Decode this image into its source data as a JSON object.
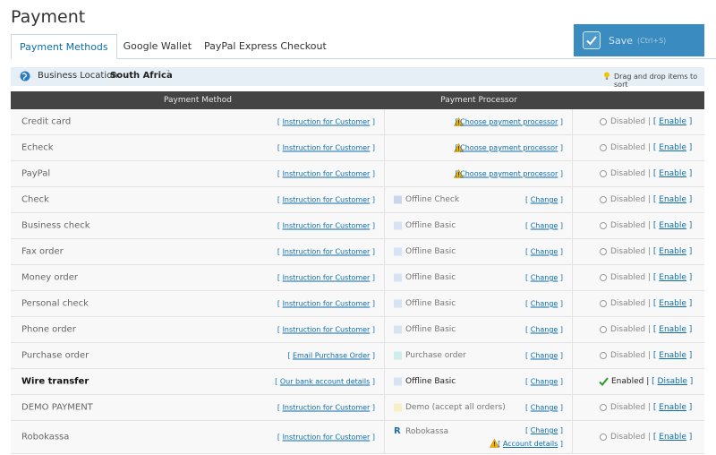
{
  "page": {
    "title": "Payment",
    "tabs": [
      {
        "label": "Payment Methods",
        "active": true
      },
      {
        "label": "Google Wallet",
        "active": false
      },
      {
        "label": "PayPal Express Checkout",
        "active": false
      }
    ]
  },
  "save": {
    "label": "Save",
    "shortcut": "(Ctrl+S)"
  },
  "location": {
    "label": "Business Location:",
    "value": "South Africa",
    "help": "?",
    "drag_hint": "Drag and drop items to sort"
  },
  "table": {
    "headers": {
      "method": "Payment Method",
      "processor": "Payment Processor"
    },
    "rows": [
      {
        "name": "Credit card",
        "bold": false,
        "link_open": "[ ",
        "link": "Instruction for Customer",
        "link_close": " ]",
        "processor": {
          "type": "choose",
          "warn_icon": "warning-icon",
          "link": "Choose payment processor"
        },
        "status": {
          "enabled": false,
          "text": "Disabled",
          "sep": "|",
          "action": "Enable"
        }
      },
      {
        "name": "Echeck",
        "bold": false,
        "link_open": "[ ",
        "link": "Instruction for Customer",
        "link_close": " ]",
        "processor": {
          "type": "choose",
          "warn_icon": "warning-icon",
          "link": "Choose payment processor"
        },
        "status": {
          "enabled": false,
          "text": "Disabled",
          "sep": "|",
          "action": "Enable"
        }
      },
      {
        "name": "PayPal",
        "bold": false,
        "link_open": "[ ",
        "link": "Instruction for Customer",
        "link_close": " ]",
        "processor": {
          "type": "choose",
          "warn_icon": "warning-icon",
          "link": "Choose payment processor"
        },
        "status": {
          "enabled": false,
          "text": "Disabled",
          "sep": "|",
          "action": "Enable"
        }
      },
      {
        "name": "Check",
        "bold": false,
        "link_open": "[ ",
        "link": "Instruction for Customer",
        "link_close": " ]",
        "processor": {
          "type": "named",
          "name": "Offline Check",
          "swatch": "#c9d6ee",
          "link": "Change"
        },
        "status": {
          "enabled": false,
          "text": "Disabled",
          "sep": "|",
          "action": "Enable"
        }
      },
      {
        "name": "Business check",
        "bold": false,
        "link_open": "[ ",
        "link": "Instruction for Customer",
        "link_close": " ]",
        "processor": {
          "type": "named",
          "name": "Offline Basic",
          "swatch": "#d5e3f2",
          "link": "Change"
        },
        "status": {
          "enabled": false,
          "text": "Disabled",
          "sep": "|",
          "action": "Enable"
        }
      },
      {
        "name": "Fax order",
        "bold": false,
        "link_open": "[ ",
        "link": "Instruction for Customer",
        "link_close": " ]",
        "processor": {
          "type": "named",
          "name": "Offline Basic",
          "swatch": "#d5e3f2",
          "link": "Change"
        },
        "status": {
          "enabled": false,
          "text": "Disabled",
          "sep": "|",
          "action": "Enable"
        }
      },
      {
        "name": "Money order",
        "bold": false,
        "link_open": "[ ",
        "link": "Instruction for Customer",
        "link_close": " ]",
        "processor": {
          "type": "named",
          "name": "Offline Basic",
          "swatch": "#d5e3f2",
          "link": "Change"
        },
        "status": {
          "enabled": false,
          "text": "Disabled",
          "sep": "|",
          "action": "Enable"
        }
      },
      {
        "name": "Personal check",
        "bold": false,
        "link_open": "[ ",
        "link": "Instruction for Customer",
        "link_close": " ]",
        "processor": {
          "type": "named",
          "name": "Offline Basic",
          "swatch": "#d5e3f2",
          "link": "Change"
        },
        "status": {
          "enabled": false,
          "text": "Disabled",
          "sep": "|",
          "action": "Enable"
        }
      },
      {
        "name": "Phone order",
        "bold": false,
        "link_open": "[ ",
        "link": "Instruction for Customer",
        "link_close": " ]",
        "processor": {
          "type": "named",
          "name": "Offline Basic",
          "swatch": "#d5e3f2",
          "link": "Change"
        },
        "status": {
          "enabled": false,
          "text": "Disabled",
          "sep": "|",
          "action": "Enable"
        }
      },
      {
        "name": "Purchase order",
        "bold": false,
        "link_open": "[ ",
        "link": "Email Purchase Order",
        "link_close": " ]",
        "processor": {
          "type": "named",
          "name": "Purchase order",
          "swatch": "#cdeeed",
          "link": "Change"
        },
        "status": {
          "enabled": false,
          "text": "Disabled",
          "sep": "|",
          "action": "Enable"
        }
      },
      {
        "name": "Wire transfer",
        "bold": true,
        "link_open": "[ ",
        "link": "Our bank account details",
        "link_close": " ]",
        "processor": {
          "type": "named",
          "name": "Offline Basic",
          "swatch": "#d5e3f2",
          "link": "Change",
          "dark": true
        },
        "status": {
          "enabled": true,
          "text": "Enabled",
          "sep": "|",
          "action": "Disable"
        }
      },
      {
        "name": "DEMO PAYMENT",
        "bold": false,
        "link_open": "[ ",
        "link": "Instruction for Customer",
        "link_close": " ]",
        "processor": {
          "type": "named",
          "name": "Demo (accept all orders)",
          "swatch": "#f7efc7",
          "link": "Change"
        },
        "status": {
          "enabled": false,
          "text": "Disabled",
          "sep": "|",
          "action": "Enable"
        }
      },
      {
        "name": "Robokassa",
        "bold": false,
        "link_open": "[ ",
        "link": "Instruction for Customer",
        "link_close": " ]",
        "processor": {
          "type": "robokassa",
          "logo": "R",
          "name": "Robokassa",
          "link": "Change",
          "details": "Account details"
        },
        "status": {
          "enabled": false,
          "text": "Disabled",
          "sep": "|",
          "action": "Enable"
        }
      }
    ]
  },
  "colors": {
    "header_bg": "#444444",
    "accent": "#3a8bbf",
    "link": "#0e6ea8",
    "warning": "#f2b200",
    "enabled_check": "#2e9a2e"
  }
}
